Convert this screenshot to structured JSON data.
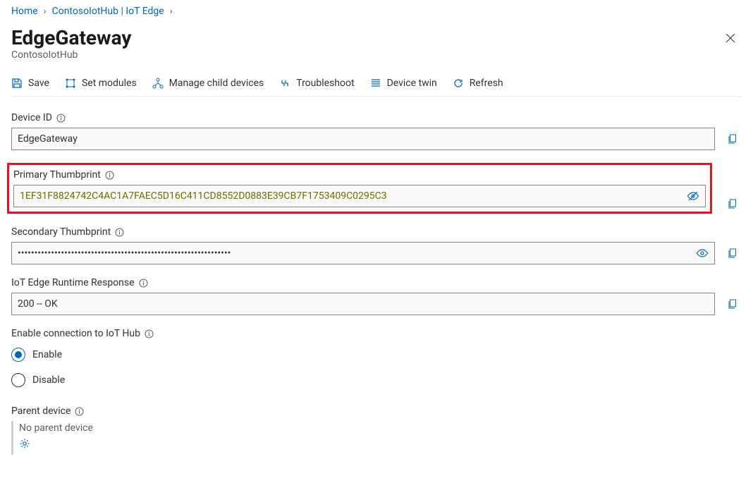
{
  "breadcrumb": {
    "home": "Home",
    "hub": "ContosoIotHub | IoT Edge"
  },
  "header": {
    "title": "EdgeGateway",
    "subtitle": "ContosoIotHub"
  },
  "toolbar": {
    "save": "Save",
    "set_modules": "Set modules",
    "manage_children": "Manage child devices",
    "troubleshoot": "Troubleshoot",
    "device_twin": "Device twin",
    "refresh": "Refresh"
  },
  "fields": {
    "device_id": {
      "label": "Device ID",
      "value": "EdgeGateway"
    },
    "primary_thumbprint": {
      "label": "Primary Thumbprint",
      "value": "1EF31F8824742C4AC1A7FAEC5D16C411CD8552D0883E39CB7F1753409C0295C3"
    },
    "secondary_thumbprint": {
      "label": "Secondary Thumbprint",
      "masked": "••••••••••••••••••••••••••••••••••••••••••••••••••••••••••••••••"
    },
    "runtime_response": {
      "label": "IoT Edge Runtime Response",
      "value": "200 -- OK"
    },
    "enable_connection": {
      "label": "Enable connection to IoT Hub",
      "enable": "Enable",
      "disable": "Disable",
      "selected": "enable"
    },
    "parent_device": {
      "label": "Parent device",
      "value": "No parent device"
    }
  }
}
